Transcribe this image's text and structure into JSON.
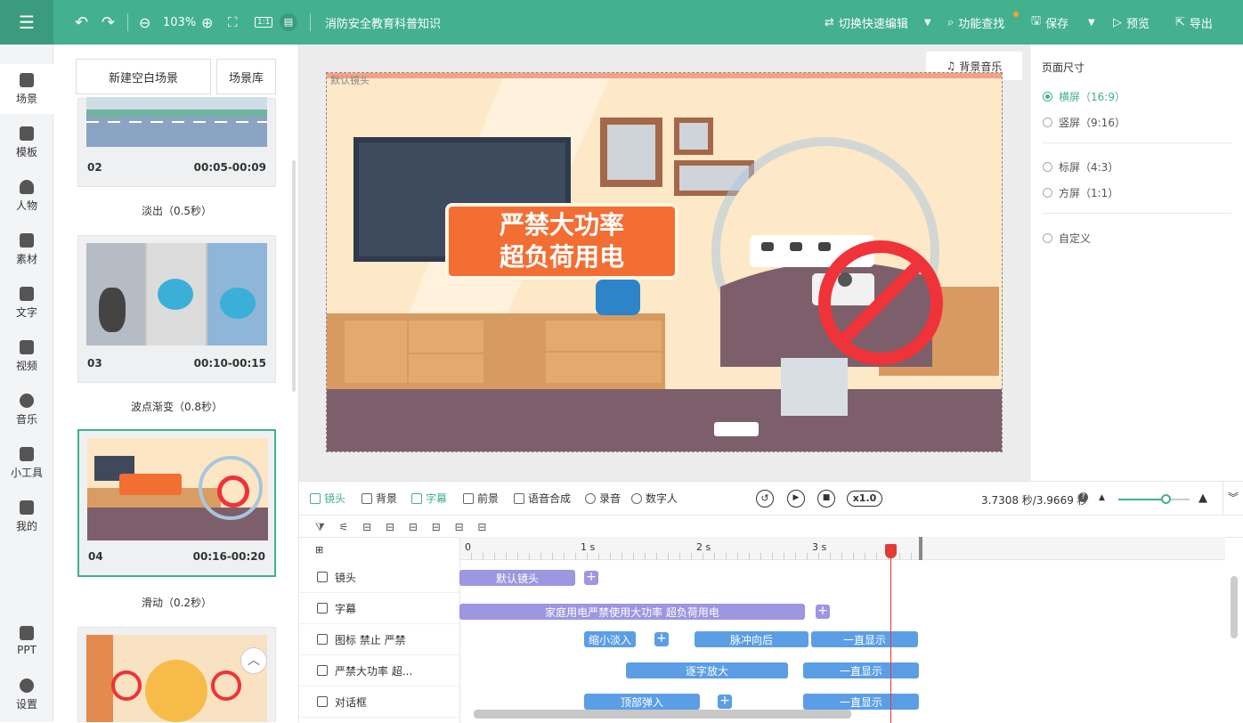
{
  "topbar": {
    "zoom": "103%",
    "project_title": "消防安全教育科普知识",
    "switch_edit": "切换快速编辑",
    "feature_search": "功能查找",
    "save": "保存",
    "preview": "预览",
    "export": "导出"
  },
  "sidebar": {
    "items": [
      {
        "label": "场景"
      },
      {
        "label": "模板"
      },
      {
        "label": "人物"
      },
      {
        "label": "素材"
      },
      {
        "label": "文字"
      },
      {
        "label": "视频"
      },
      {
        "label": "音乐"
      },
      {
        "label": "小工具"
      },
      {
        "label": "我的"
      },
      {
        "label": "PPT"
      },
      {
        "label": "设置"
      }
    ]
  },
  "scenes": {
    "new_blank": "新建空白场景",
    "library": "场景库",
    "cards": [
      {
        "num": "02",
        "time": "00:05-00:09",
        "transition": "淡出（0.5秒）"
      },
      {
        "num": "03",
        "time": "00:10-00:15",
        "transition": "波点渐变（0.8秒）"
      },
      {
        "num": "04",
        "time": "00:16-00:20",
        "transition": "滑动（0.2秒）"
      }
    ]
  },
  "canvas": {
    "bg_music": "背景音乐",
    "camera_label": "默认镜头",
    "banner_line1": "严禁大功率",
    "banner_line2": "超负荷用电"
  },
  "right_panel": {
    "title": "页面尺寸",
    "options": [
      "横屏（16:9）",
      "竖屏（9:16）",
      "标屏（4:3）",
      "方屏（1:1）",
      "自定义"
    ],
    "selected": "横屏（16:9）"
  },
  "timeline": {
    "tabs": [
      "镜头",
      "背景",
      "字幕",
      "前景",
      "语音合成",
      "录音",
      "数字人"
    ],
    "speed": "x1.0",
    "time": "3.7308 秒/3.9669 秒",
    "ruler": [
      "0",
      "1 s",
      "2 s",
      "3 s"
    ],
    "tracks": [
      {
        "label": "镜头",
        "clips": [
          "默认镜头"
        ]
      },
      {
        "label": "字幕",
        "clips": [
          "家庭用电严禁使用大功率 超负荷用电"
        ]
      },
      {
        "label": "图标 禁止 严禁",
        "clips": [
          "缩小淡入",
          "脉冲向后",
          "一直显示"
        ]
      },
      {
        "label": "严禁大功率 超...",
        "clips": [
          "逐字放大",
          "一直显示"
        ]
      },
      {
        "label": "对话框",
        "clips": [
          "顶部弹入",
          "一直显示"
        ]
      }
    ]
  },
  "colors": {
    "accent": "#43b08e",
    "clip_purple": "#9d96e0",
    "clip_blue": "#5b9ee6",
    "playhead": "#e53935"
  }
}
